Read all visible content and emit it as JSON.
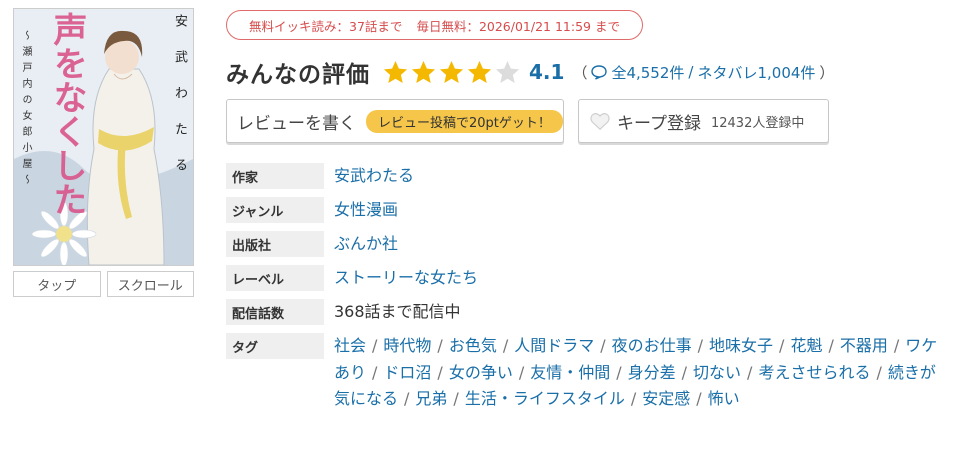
{
  "cover": {
    "title_art": "声をなくした",
    "author_vertical": "安 武 わ た る",
    "subtitle_vertical": "～瀬戸内の女郎小屋～"
  },
  "view_tabs": [
    "タップ",
    "スクロール"
  ],
  "free_info": {
    "free_read": "無料イッキ読み：37話まで",
    "daily_free": "毎日無料：2026/01/21 11:59 まで"
  },
  "rating": {
    "title": "みんなの評価",
    "value": "4.1",
    "stars_filled": 4,
    "stars_total": 5,
    "open_paren": "（",
    "total_reviews": "全4,552件",
    "slash": "/",
    "spoiler_reviews": "ネタバレ1,004件",
    "close_paren": "）",
    "colors": {
      "star_on": "#f5b800",
      "star_off": "#dcdcdc",
      "link": "#1a6fa8"
    }
  },
  "buttons": {
    "review_label": "レビューを書く",
    "review_promo": "レビュー投稿で20ptゲット！",
    "keep_label": "キープ登録",
    "keep_count": "12432人登録中"
  },
  "info": {
    "author_label": "作家",
    "author": "安武わたる",
    "genre_label": "ジャンル",
    "genre": "女性漫画",
    "publisher_label": "出版社",
    "publisher": "ぶんか社",
    "label_label": "レーベル",
    "label": "ストーリーな女たち",
    "episodes_label": "配信話数",
    "episodes": "368話まで配信中",
    "tags_label": "タグ",
    "tags": [
      "社会",
      "時代物",
      "お色気",
      "人間ドラマ",
      "夜のお仕事",
      "地味女子",
      "花魁",
      "不器用",
      "ワケあり",
      "ドロ沼",
      "女の争い",
      "友情・仲間",
      "身分差",
      "切ない",
      "考えさせられる",
      "続きが気になる",
      "兄弟",
      "生活・ライフスタイル",
      "安定感",
      "怖い"
    ]
  }
}
